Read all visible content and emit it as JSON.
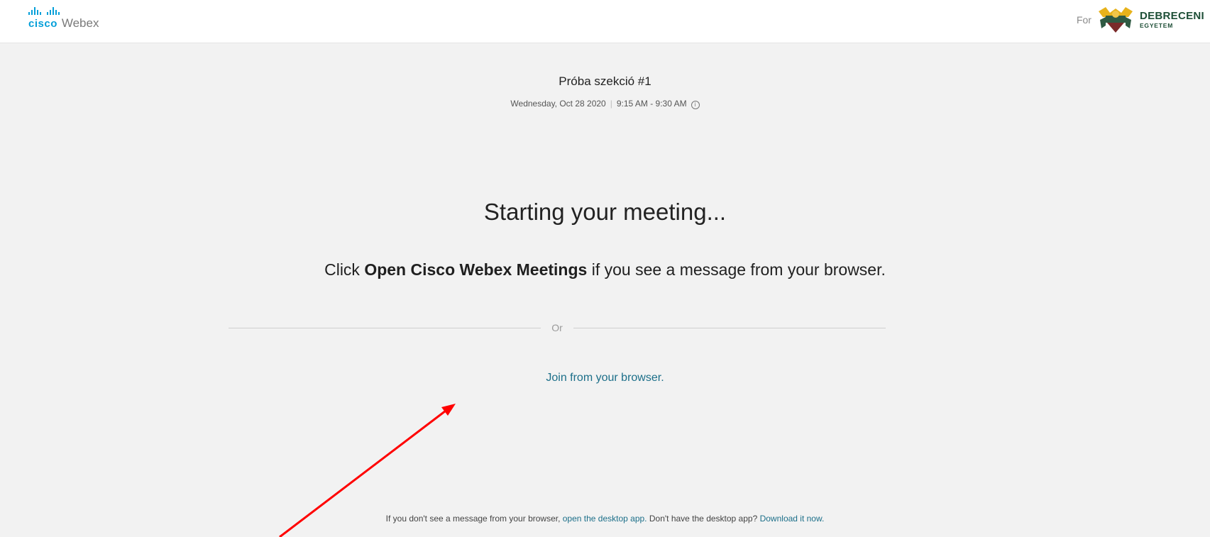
{
  "header": {
    "logo_cisco": "cisco",
    "logo_webex": "Webex",
    "for_label": "For",
    "brand_line1": "DEBRECENI",
    "brand_line2": "EGYETEM"
  },
  "meeting": {
    "title": "Próba szekció #1",
    "date": "Wednesday, Oct 28 2020",
    "separator": "|",
    "time": "9:15 AM - 9:30 AM",
    "info_glyph": "i"
  },
  "main": {
    "starting": "Starting your meeting...",
    "instruction_prefix": "Click ",
    "instruction_bold": "Open Cisco Webex Meetings",
    "instruction_suffix": " if you see a message from your browser.",
    "or_label": "Or",
    "join_link": "Join from your browser."
  },
  "footer": {
    "text1": "If you don't see a message from your browser, ",
    "link1": "open the desktop app.",
    "text2": " Don't have the desktop app? ",
    "link2": "Download it now."
  },
  "colors": {
    "accent_link": "#1c6f89",
    "cisco_blue": "#049fd9",
    "annotation_arrow": "#ff0000"
  },
  "icons": [
    "cisco-logo-icon",
    "university-crest-icon",
    "info-icon",
    "annotation-arrow"
  ]
}
